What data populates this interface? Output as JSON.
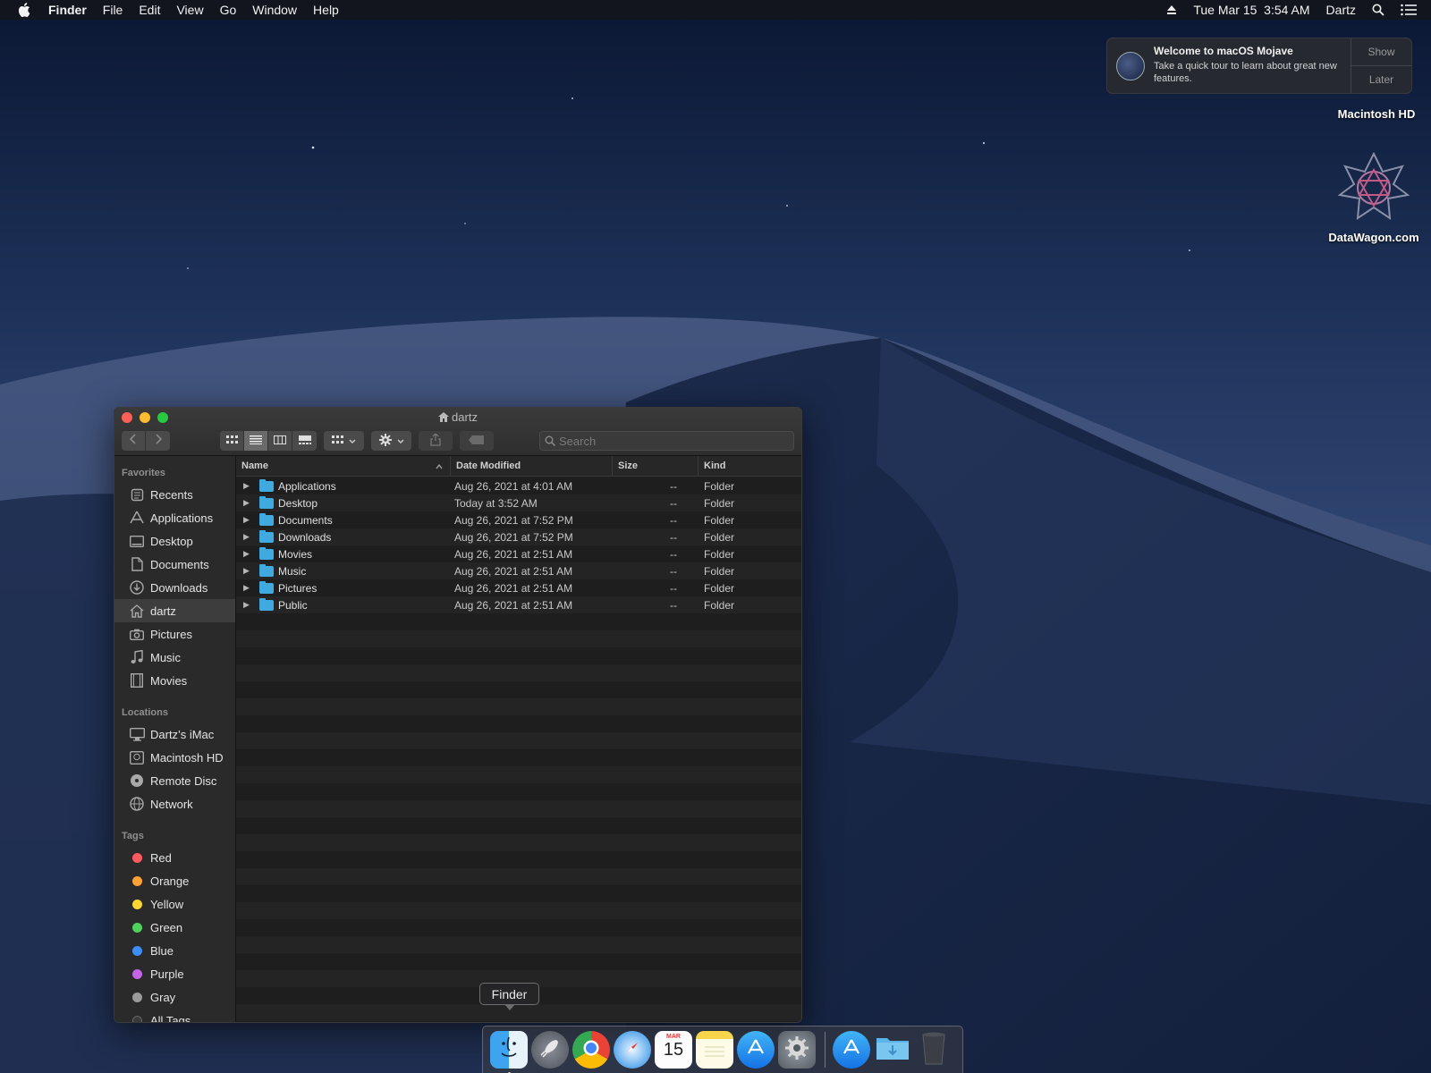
{
  "menubar": {
    "app_name": "Finder",
    "menus": [
      "File",
      "Edit",
      "View",
      "Go",
      "Window",
      "Help"
    ],
    "datetime": "Tue Mar 15  3:54 AM",
    "user": "Dartz"
  },
  "notification": {
    "title": "Welcome to macOS Mojave",
    "body": "Take a quick tour to learn about great new features.",
    "show_label": "Show",
    "later_label": "Later"
  },
  "desktop": {
    "drive_label": "Macintosh HD",
    "logo_label": "DataWagon.com"
  },
  "window": {
    "title": "dartz",
    "search_placeholder": "Search",
    "sidebar": {
      "favorites_heading": "Favorites",
      "favorites": [
        "Recents",
        "Applications",
        "Desktop",
        "Documents",
        "Downloads",
        "dartz",
        "Pictures",
        "Music",
        "Movies"
      ],
      "locations_heading": "Locations",
      "locations": [
        "Dartz’s iMac",
        "Macintosh HD",
        "Remote Disc",
        "Network"
      ],
      "tags_heading": "Tags",
      "tags": [
        {
          "label": "Red",
          "color": "#ff5a5f"
        },
        {
          "label": "Orange",
          "color": "#ffa234"
        },
        {
          "label": "Yellow",
          "color": "#fbd534"
        },
        {
          "label": "Green",
          "color": "#4fd15c"
        },
        {
          "label": "Blue",
          "color": "#3d8ef7"
        },
        {
          "label": "Purple",
          "color": "#c264e6"
        },
        {
          "label": "Gray",
          "color": "#9a9a9a"
        }
      ],
      "all_tags": "All Tags..."
    },
    "columns": {
      "name": "Name",
      "date": "Date Modified",
      "size": "Size",
      "kind": "Kind"
    },
    "rows": [
      {
        "name": "Applications",
        "date": "Aug 26, 2021 at 4:01 AM",
        "size": "--",
        "kind": "Folder"
      },
      {
        "name": "Desktop",
        "date": "Today at 3:52 AM",
        "size": "--",
        "kind": "Folder"
      },
      {
        "name": "Documents",
        "date": "Aug 26, 2021 at 7:52 PM",
        "size": "--",
        "kind": "Folder"
      },
      {
        "name": "Downloads",
        "date": "Aug 26, 2021 at 7:52 PM",
        "size": "--",
        "kind": "Folder"
      },
      {
        "name": "Movies",
        "date": "Aug 26, 2021 at 2:51 AM",
        "size": "--",
        "kind": "Folder"
      },
      {
        "name": "Music",
        "date": "Aug 26, 2021 at 2:51 AM",
        "size": "--",
        "kind": "Folder"
      },
      {
        "name": "Pictures",
        "date": "Aug 26, 2021 at 2:51 AM",
        "size": "--",
        "kind": "Folder"
      },
      {
        "name": "Public",
        "date": "Aug 26, 2021 at 2:51 AM",
        "size": "--",
        "kind": "Folder"
      }
    ]
  },
  "dock": {
    "tooltip": "Finder",
    "calendar_month": "MAR",
    "calendar_day": "15"
  }
}
